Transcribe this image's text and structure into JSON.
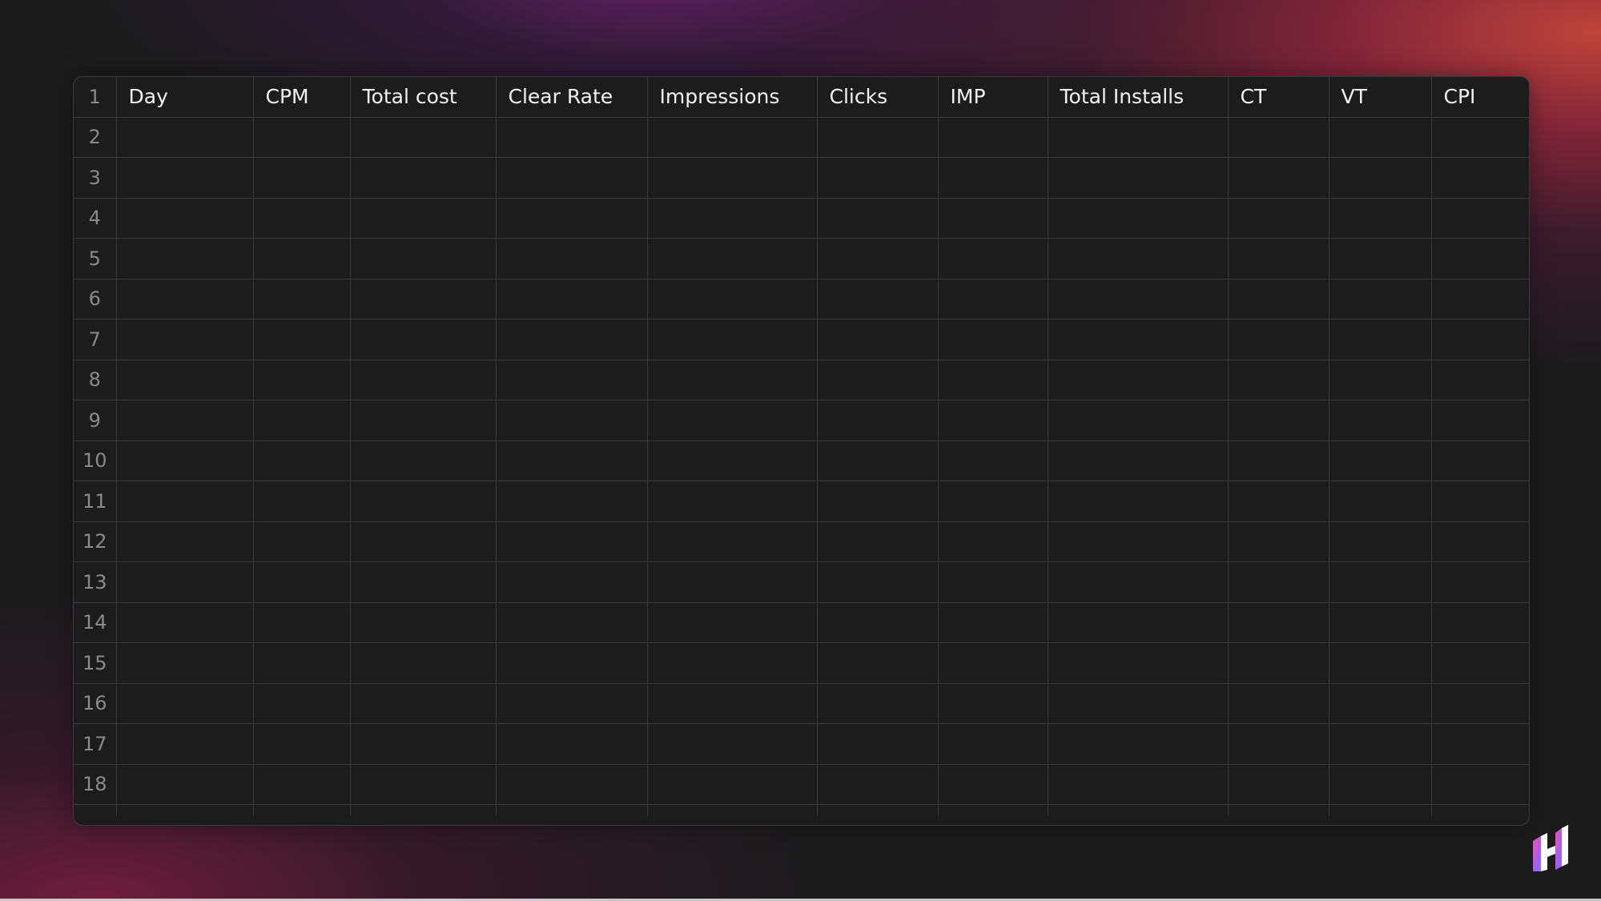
{
  "sheet": {
    "columns": [
      "Day",
      "CPM",
      "Total cost",
      "Clear Rate",
      "Impressions",
      "Clicks",
      "IMP",
      "Total Installs",
      "CT",
      "VT",
      "CPI"
    ],
    "row_numbers": [
      "1",
      "2",
      "3",
      "4",
      "5",
      "6",
      "7",
      "8",
      "9",
      "10",
      "11",
      "12",
      "13",
      "14",
      "15",
      "16",
      "17",
      "18"
    ]
  },
  "colors": {
    "background": "#1b1b1c",
    "grid_line": "#3a3a3c",
    "header_text": "#f2f2f2",
    "row_number_text": "#8a8a8c",
    "accent_red": "#c8463c",
    "accent_purple": "#6e236e"
  },
  "logo": {
    "icon": "h-brand-logo-icon"
  }
}
